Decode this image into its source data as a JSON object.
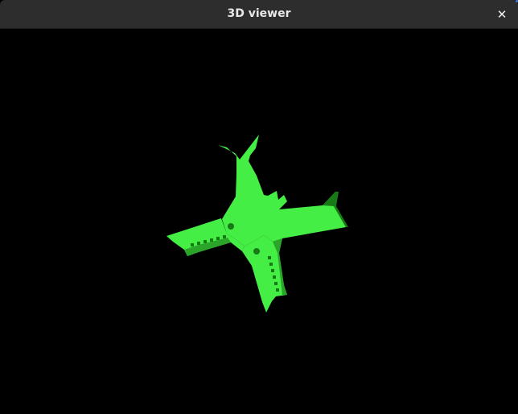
{
  "window": {
    "title": "3D viewer",
    "close_glyph": "✕"
  },
  "viewport": {
    "background": "#000000",
    "model": {
      "name": "airplane",
      "color": "#44ee44",
      "shade_color": "#2aa52a",
      "dark_color": "#177a17"
    }
  }
}
